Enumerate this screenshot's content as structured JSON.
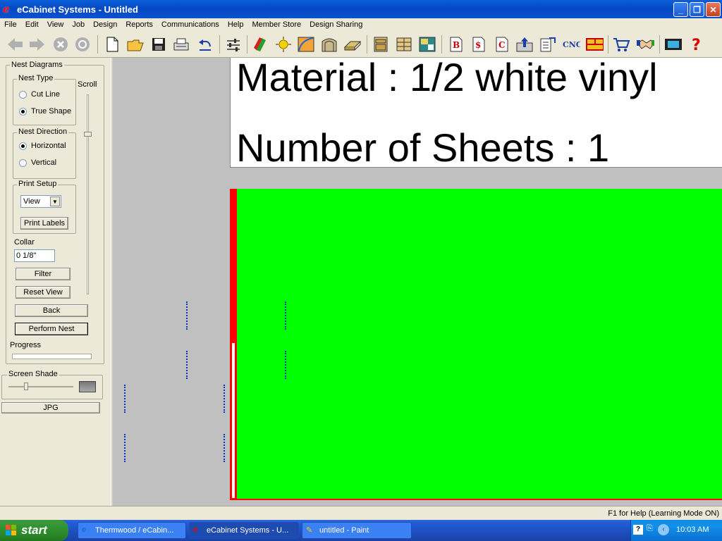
{
  "window": {
    "title": "eCabinet Systems - Untitled"
  },
  "menu": [
    "File",
    "Edit",
    "View",
    "Job",
    "Design",
    "Reports",
    "Communications",
    "Help",
    "Member Store",
    "Design Sharing"
  ],
  "toolbar": {
    "cnc_label": "CNC",
    "b_label": "B",
    "dollar_label": "$",
    "c_label": "C",
    "help_label": "?"
  },
  "panel": {
    "group_title": "Nest Diagrams",
    "nest_type_title": "Nest Type",
    "cut_line": "Cut Line",
    "true_shape": "True Shape",
    "scroll_label": "Scroll",
    "nest_direction_title": "Nest Direction",
    "horizontal": "Horizontal",
    "vertical": "Vertical",
    "print_setup_title": "Print Setup",
    "view_select": "View",
    "print_labels": "Print Labels",
    "collar_label": "Collar",
    "collar_value": "0 1/8\"",
    "filter": "Filter",
    "reset_view": "Reset View",
    "back": "Back",
    "perform_nest": "Perform Nest",
    "progress_label": "Progress",
    "progress_value": 0,
    "screen_shade_label": "Screen Shade",
    "screen_shade_level": 0.25,
    "jpg": "JPG"
  },
  "canvas": {
    "material_line": "Material :  1/2 white vinyl",
    "sheets_line": "Number of Sheets :  1"
  },
  "status": {
    "help": "F1 for Help (Learning Mode ON)"
  },
  "taskbar": {
    "start": "start",
    "tasks": [
      "Thermwood / eCabin...",
      "eCabinet Systems - U...",
      "untitled - Paint"
    ],
    "clock": "10:03 AM"
  }
}
